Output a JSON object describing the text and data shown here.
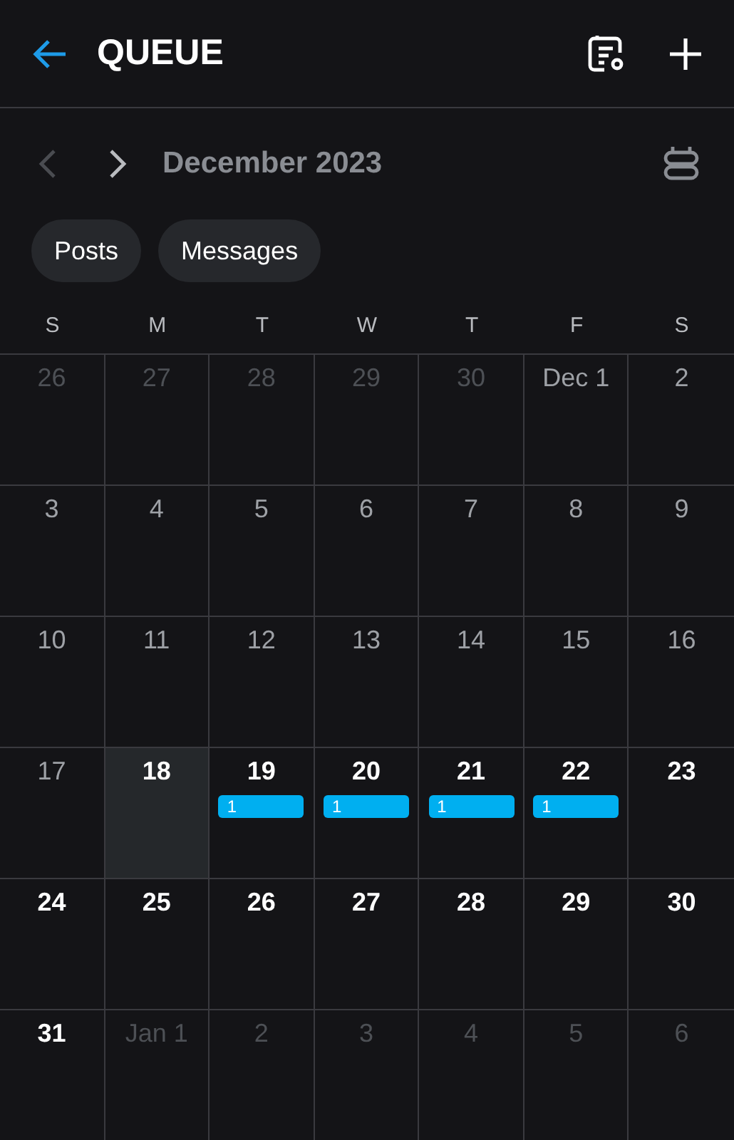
{
  "header": {
    "title": "QUEUE"
  },
  "month_nav": {
    "prev_disabled": true,
    "next_disabled": false,
    "month": "December 2023"
  },
  "filters": [
    {
      "label": "Posts",
      "selected": false
    },
    {
      "label": "Messages",
      "selected": false
    }
  ],
  "weekdays": [
    "S",
    "M",
    "T",
    "W",
    "T",
    "F",
    "S"
  ],
  "weeks": [
    [
      {
        "label": "26",
        "kind": "other_month",
        "selected": false
      },
      {
        "label": "27",
        "kind": "other_month",
        "selected": false
      },
      {
        "label": "28",
        "kind": "other_month",
        "selected": false
      },
      {
        "label": "29",
        "kind": "other_month",
        "selected": false
      },
      {
        "label": "30",
        "kind": "other_month",
        "selected": false
      },
      {
        "label": "Dec 1",
        "kind": "past",
        "selected": false
      },
      {
        "label": "2",
        "kind": "past",
        "selected": false
      }
    ],
    [
      {
        "label": "3",
        "kind": "past",
        "selected": false
      },
      {
        "label": "4",
        "kind": "past",
        "selected": false
      },
      {
        "label": "5",
        "kind": "past",
        "selected": false
      },
      {
        "label": "6",
        "kind": "past",
        "selected": false
      },
      {
        "label": "7",
        "kind": "past",
        "selected": false
      },
      {
        "label": "8",
        "kind": "past",
        "selected": false
      },
      {
        "label": "9",
        "kind": "past",
        "selected": false
      }
    ],
    [
      {
        "label": "10",
        "kind": "past",
        "selected": false
      },
      {
        "label": "11",
        "kind": "past",
        "selected": false
      },
      {
        "label": "12",
        "kind": "past",
        "selected": false
      },
      {
        "label": "13",
        "kind": "past",
        "selected": false
      },
      {
        "label": "14",
        "kind": "past",
        "selected": false
      },
      {
        "label": "15",
        "kind": "past",
        "selected": false
      },
      {
        "label": "16",
        "kind": "past",
        "selected": false
      }
    ],
    [
      {
        "label": "17",
        "kind": "past",
        "selected": false
      },
      {
        "label": "18",
        "kind": "upcoming",
        "selected": true
      },
      {
        "label": "19",
        "kind": "upcoming",
        "selected": false,
        "event": "1"
      },
      {
        "label": "20",
        "kind": "upcoming",
        "selected": false,
        "event": "1"
      },
      {
        "label": "21",
        "kind": "upcoming",
        "selected": false,
        "event": "1"
      },
      {
        "label": "22",
        "kind": "upcoming",
        "selected": false,
        "event": "1"
      },
      {
        "label": "23",
        "kind": "upcoming",
        "selected": false
      }
    ],
    [
      {
        "label": "24",
        "kind": "upcoming",
        "selected": false
      },
      {
        "label": "25",
        "kind": "upcoming",
        "selected": false
      },
      {
        "label": "26",
        "kind": "upcoming",
        "selected": false
      },
      {
        "label": "27",
        "kind": "upcoming",
        "selected": false
      },
      {
        "label": "28",
        "kind": "upcoming",
        "selected": false
      },
      {
        "label": "29",
        "kind": "upcoming",
        "selected": false
      },
      {
        "label": "30",
        "kind": "upcoming",
        "selected": false
      }
    ],
    [
      {
        "label": "31",
        "kind": "upcoming",
        "selected": false
      },
      {
        "label": "Jan 1",
        "kind": "other_month",
        "selected": false
      },
      {
        "label": "2",
        "kind": "other_month",
        "selected": false
      },
      {
        "label": "3",
        "kind": "other_month",
        "selected": false
      },
      {
        "label": "4",
        "kind": "other_month",
        "selected": false
      },
      {
        "label": "5",
        "kind": "other_month",
        "selected": false
      },
      {
        "label": "6",
        "kind": "other_month",
        "selected": false
      }
    ]
  ]
}
